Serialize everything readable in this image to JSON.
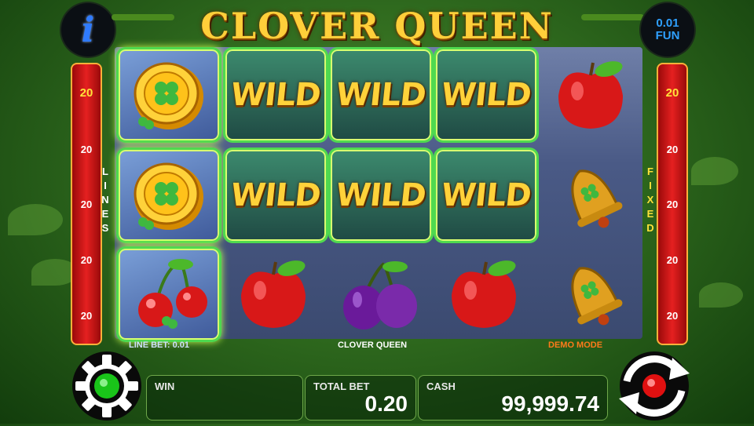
{
  "title": "CLOVER QUEEN",
  "coin": {
    "value": "0.01",
    "label": "FUN"
  },
  "lines_left": [
    "20",
    "20",
    "20",
    "20",
    "20"
  ],
  "lines_right": [
    "20",
    "20",
    "20",
    "20",
    "20"
  ],
  "side_labels": {
    "left": "LINES",
    "right": "FIXED"
  },
  "reels": [
    [
      "coin",
      "coin",
      "cherries"
    ],
    [
      "WILD",
      "WILD",
      "apple"
    ],
    [
      "WILD",
      "WILD",
      "plum"
    ],
    [
      "WILD",
      "WILD",
      "apple"
    ],
    [
      "apple",
      "bell",
      "bell"
    ]
  ],
  "status": {
    "line_bet": "LINE BET: 0.01",
    "game_name": "CLOVER QUEEN",
    "mode": "DEMO MODE"
  },
  "bottom": {
    "win_label": "WIN",
    "win_value": "",
    "total_bet_label": "TOTAL BET",
    "total_bet_value": "0.20",
    "cash_label": "CASH",
    "cash_value": "99,999.74"
  },
  "icons": {
    "info": "info-icon",
    "settings": "gear-icon",
    "spin": "spin-arrows-icon"
  },
  "colors": {
    "title": "#ffcf3a",
    "line_strip": "#e52020",
    "win_border": "#4fd94f",
    "status_mode": "#ff7a1a"
  }
}
